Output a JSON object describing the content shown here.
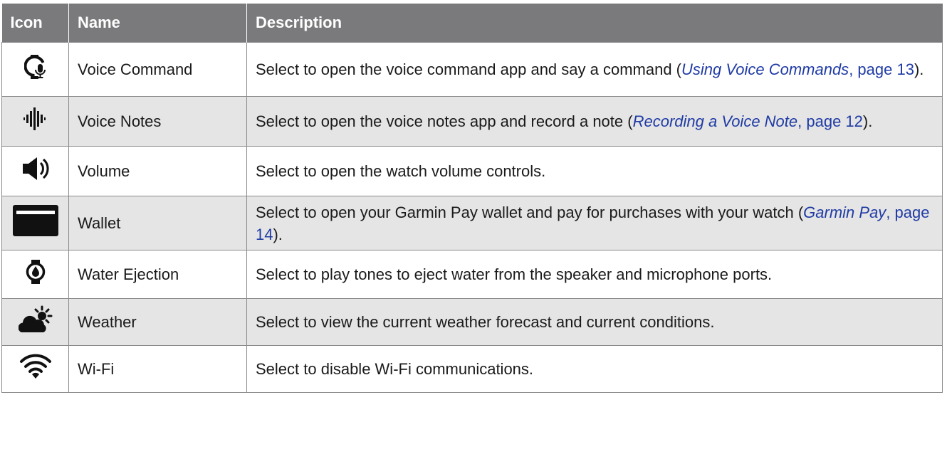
{
  "headers": {
    "icon": "Icon",
    "name": "Name",
    "description": "Description"
  },
  "rows": [
    {
      "icon": "watch-microphone-icon",
      "name": "Voice Command",
      "desc_pre": "Select to open the voice command app and say a command (",
      "link_title": "Using Voice Commands",
      "link_page": ", page 13",
      "desc_post": ")."
    },
    {
      "icon": "sound-wave-icon",
      "name": "Voice Notes",
      "desc_pre": "Select to open the voice notes app and record a note (",
      "link_title": "Recording a Voice Note",
      "link_page": ", page 12",
      "desc_post": ")."
    },
    {
      "icon": "speaker-volume-icon",
      "name": "Volume",
      "desc": "Select to open the watch volume controls."
    },
    {
      "icon": "wallet-card-icon",
      "name": "Wallet",
      "desc_pre": "Select to open your Garmin Pay wallet and pay for purchases with your watch (",
      "link_title": "Garmin Pay",
      "link_page": ", page 14",
      "desc_post": ")."
    },
    {
      "icon": "watch-water-drop-icon",
      "name": "Water Ejection",
      "desc": "Select to play tones to eject water from the speaker and microphone ports."
    },
    {
      "icon": "weather-cloud-sun-icon",
      "name": "Weather",
      "desc": "Select to view the current weather forecast and current conditions."
    },
    {
      "icon": "wifi-icon",
      "name": "Wi-Fi",
      "desc": "Select to disable Wi-Fi communications."
    }
  ],
  "colors": {
    "header_bg": "#7a7a7c",
    "shaded_row": "#e5e5e5",
    "link": "#1f3ba5",
    "border": "#8a8a8a"
  }
}
